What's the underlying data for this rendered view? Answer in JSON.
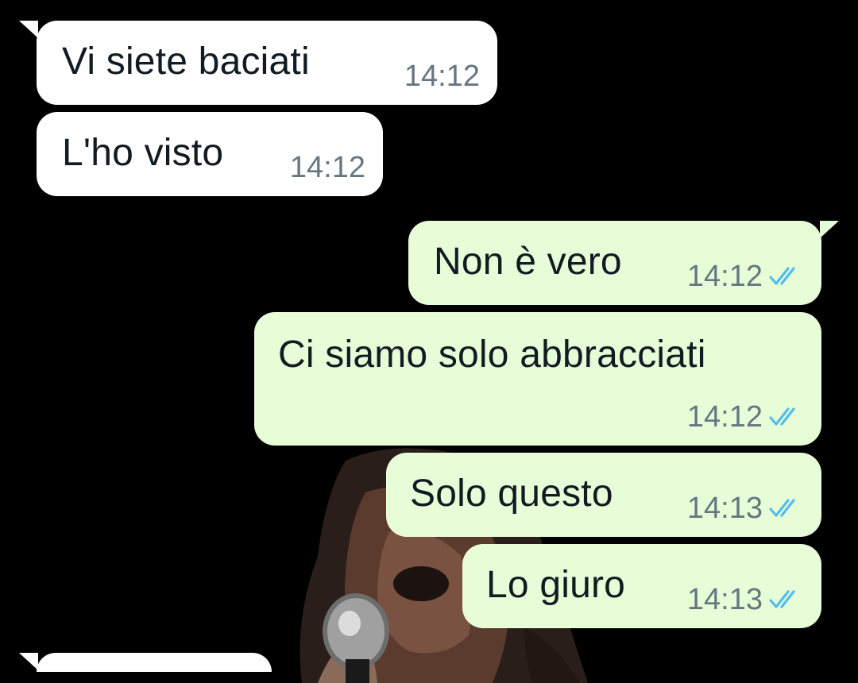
{
  "chat": {
    "messages": [
      {
        "direction": "incoming",
        "text": "Vi siete baciati",
        "time": "14:12"
      },
      {
        "direction": "incoming",
        "text": "L'ho visto",
        "time": "14:12"
      },
      {
        "direction": "outgoing",
        "text": "Non è vero",
        "time": "14:12",
        "status": "read"
      },
      {
        "direction": "outgoing",
        "text": "Ci siamo solo abbracciati",
        "time": "14:12",
        "status": "read"
      },
      {
        "direction": "outgoing",
        "text": "Solo questo",
        "time": "14:13",
        "status": "read"
      },
      {
        "direction": "outgoing",
        "text": "Lo giuro",
        "time": "14:13",
        "status": "read"
      }
    ],
    "colors": {
      "background": "#000000",
      "incoming_bubble": "#ffffff",
      "outgoing_bubble": "#e7fdd8",
      "text": "#111b21",
      "time": "#667781",
      "read_tick": "#53bdeb"
    },
    "icons": {
      "status_read": "double-check-icon"
    }
  }
}
